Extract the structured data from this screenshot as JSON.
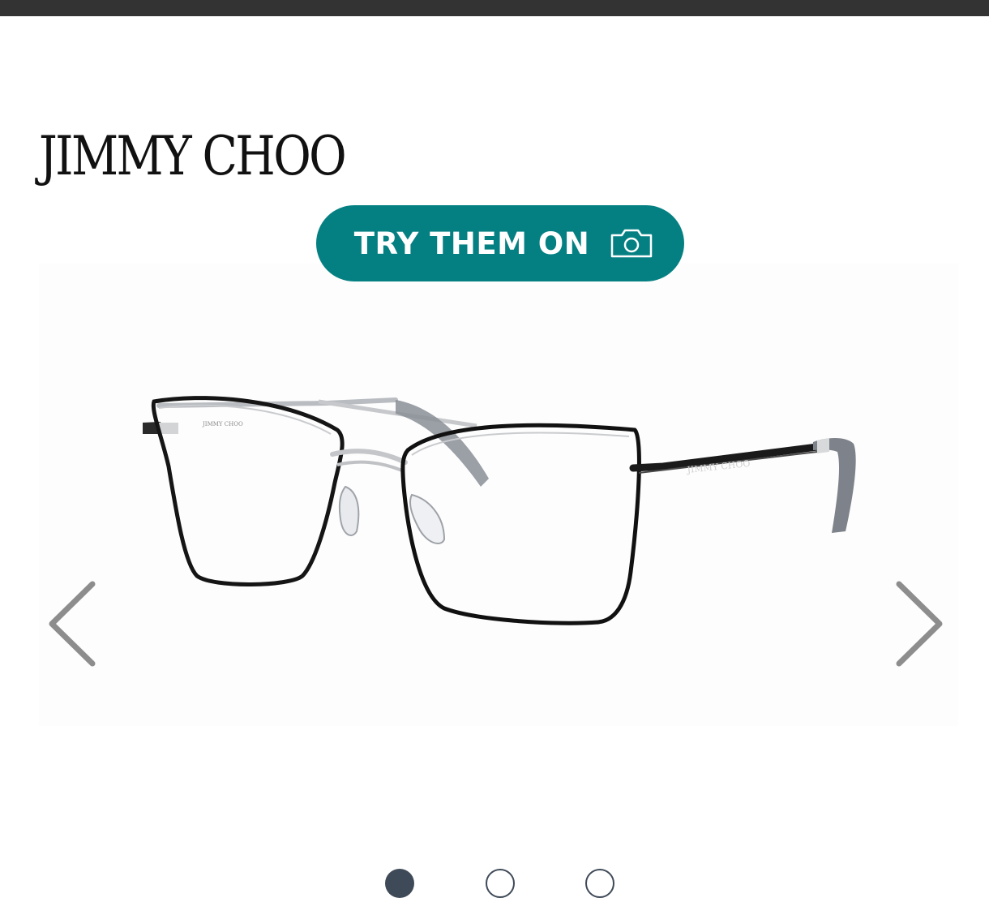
{
  "brand": {
    "name": "JIMMY CHOO"
  },
  "try_on": {
    "label": "TRY THEM ON",
    "icon": "camera-icon",
    "color": "#058082"
  },
  "product_image": {
    "frame_temple_engraving": "JIMMY CHOO",
    "frame_inner_engraving": "JIMMY CHOO"
  },
  "carousel": {
    "prev_icon": "chevron-left-icon",
    "next_icon": "chevron-right-icon",
    "slide_count": 3,
    "active_index": 0,
    "dot_color": "#3f4a58"
  },
  "colors": {
    "top_bar": "#333333",
    "background": "#ffffff"
  }
}
